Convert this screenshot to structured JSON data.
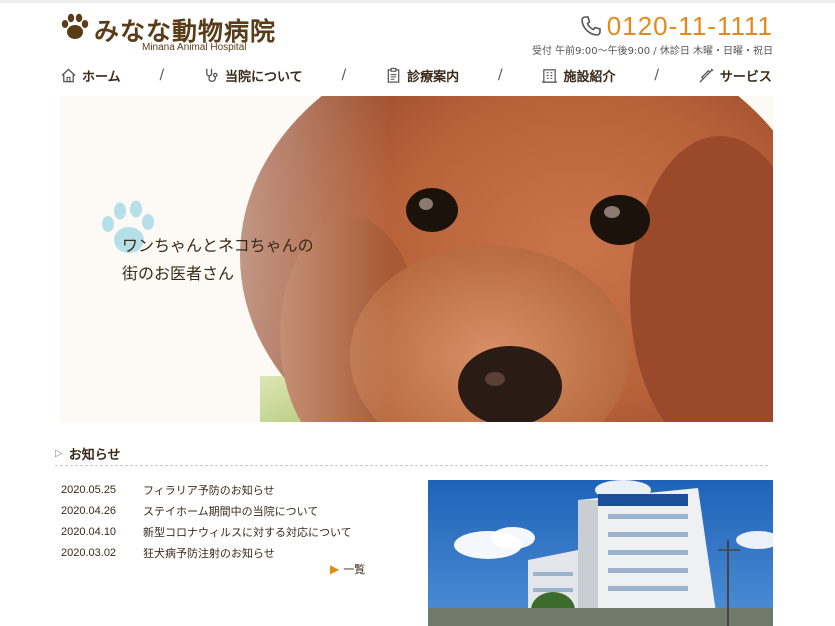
{
  "header": {
    "logo_title": "みなな動物病院",
    "logo_subtitle": "Minana Animal Hospital",
    "phone": "0120-11-1111",
    "hours": "受付 午前9:00〜午後9:00 / 休診日 木曜・日曜・祝日"
  },
  "nav": {
    "items": [
      {
        "label": "ホーム",
        "icon": "home-icon"
      },
      {
        "label": "当院について",
        "icon": "stethoscope-icon"
      },
      {
        "label": "診療案内",
        "icon": "clipboard-icon"
      },
      {
        "label": "施設紹介",
        "icon": "building-icon"
      },
      {
        "label": "サービス",
        "icon": "syringe-icon"
      }
    ],
    "separator": "/"
  },
  "hero": {
    "tagline_line1": "ワンちゃんとネコちゃんの",
    "tagline_line2": "街のお医者さん"
  },
  "news": {
    "heading": "お知らせ",
    "items": [
      {
        "date": "2020.05.25",
        "text": "フィラリア予防のお知らせ"
      },
      {
        "date": "2020.04.26",
        "text": "ステイホーム期間中の当院について"
      },
      {
        "date": "2020.04.10",
        "text": "新型コロナウィルスに対する対応について"
      },
      {
        "date": "2020.03.02",
        "text": "狂犬病予防注射のお知らせ"
      }
    ],
    "more_label": "一覧"
  },
  "colors": {
    "accent": "#e48a1c",
    "brand_brown": "#5a3d18",
    "paw_blue": "#a9dbe6"
  }
}
